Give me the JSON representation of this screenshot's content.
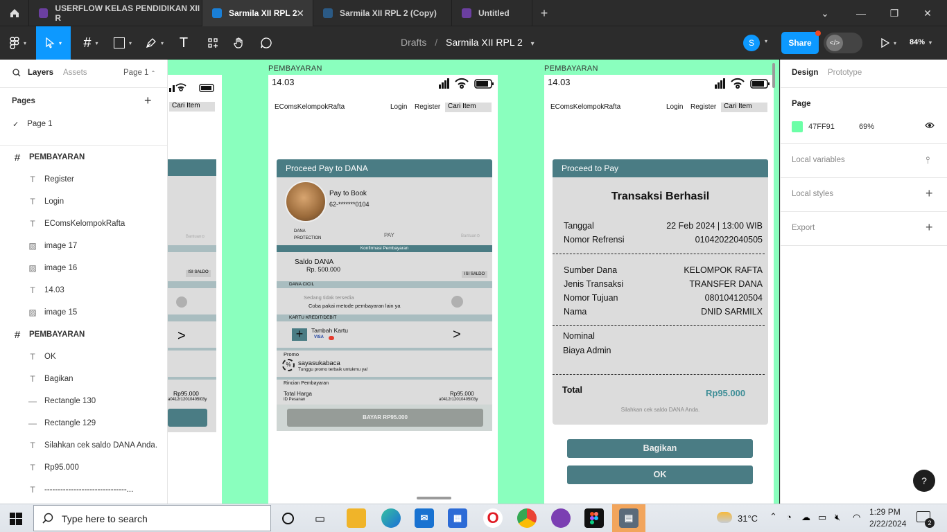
{
  "tabs": [
    {
      "label": "USERFLOW KELAS PENDIDIKAN XII R",
      "active": false
    },
    {
      "label": "Sarmila XII RPL 2",
      "active": true
    },
    {
      "label": "Sarmila XII RPL 2 (Copy)",
      "active": false
    },
    {
      "label": "Untitled",
      "active": false
    }
  ],
  "toolbar": {
    "breadcrumb_root": "Drafts",
    "breadcrumb_sep": "/",
    "file_name": "Sarmila XII RPL 2",
    "avatar_initial": "S",
    "share_label": "Share",
    "zoom": "84%"
  },
  "left_panel": {
    "tab_layers": "Layers",
    "tab_assets": "Assets",
    "page_selector": "Page 1",
    "pages_heading": "Pages",
    "current_page": "Page 1",
    "layers": [
      {
        "type": "frame",
        "name": "PEMBAYARAN"
      },
      {
        "type": "text",
        "name": "Register"
      },
      {
        "type": "text",
        "name": "Login"
      },
      {
        "type": "text",
        "name": "EComsKelompokRafta"
      },
      {
        "type": "image",
        "name": "image 17"
      },
      {
        "type": "image",
        "name": "image 16"
      },
      {
        "type": "text",
        "name": "14.03"
      },
      {
        "type": "image",
        "name": "image 15"
      },
      {
        "type": "frame",
        "name": "PEMBAYARAN"
      },
      {
        "type": "text",
        "name": "OK"
      },
      {
        "type": "text",
        "name": "Bagikan"
      },
      {
        "type": "line",
        "name": "Rectangle 130"
      },
      {
        "type": "line",
        "name": "Rectangle 129"
      },
      {
        "type": "text",
        "name": "Silahkan cek saldo DANA Anda."
      },
      {
        "type": "text",
        "name": "Rp95.000"
      },
      {
        "type": "text",
        "name": "-------------------------------..."
      }
    ]
  },
  "canvas": {
    "frame_label_1": "PEMBAYARAN",
    "frame_label_2": "PEMBAYARAN",
    "partial": {
      "cari": "Cari Item",
      "bantuan": "Bantuan",
      "isi_saldo": "ISI SALDO",
      "arrow": ">",
      "price": "Rp95.000",
      "pesanan": "a0412r12010405l03y"
    },
    "phone1": {
      "time": "14.03",
      "brand": "EComsKelompokRafta",
      "login": "Login",
      "register": "Register",
      "search": "Cari Item",
      "header": "Proceed Pay to DANA",
      "pay_to": "Pay to Book",
      "account": "62-*******0104",
      "dana_protection_1": "DANA",
      "dana_protection_2": "PROTECTION",
      "pay_label": "PAY",
      "bantuan": "Bantuan",
      "confirm": "Konfirmasi Pembayaran",
      "saldo_label": "Saldo DANA",
      "saldo_value": "Rp. 500.000",
      "isi_saldo": "ISI SALDO",
      "dana_cicil": "DANA CICIL",
      "cicil_1": "Sedang tidak tersedia",
      "cicil_2": "Coba  pakai metode pembayaran lain ya",
      "kartu": "KARTU KREDIT/DEBIT",
      "tambah_kartu": "Tambah Kartu",
      "visa": "VISA",
      "arrow": ">",
      "promo": "Promo",
      "promo_name": "sayasukabaca",
      "promo_sub": "Tunggu promo terbaik untukmu ya!",
      "rincian": "Rincian Pembayaran",
      "total_harga": "Total Harga",
      "total_value": "Rp95.000",
      "id_pesanan": "ID Pesanan",
      "id_value": "a0412r12010405l03y",
      "bayar": "BAYAR RP95.000"
    },
    "phone2": {
      "time": "14.03",
      "brand": "EComsKelompokRafta",
      "login": "Login",
      "register": "Register",
      "search": "Cari Item",
      "header": "Proceed to Pay",
      "title": "Transaksi Berhasil",
      "rows1": [
        {
          "k": "Tanggal",
          "v": "22 Feb 2024 | 13:00 WIB"
        },
        {
          "k": "Nomor Refrensi",
          "v": "01042022040505"
        }
      ],
      "rows2": [
        {
          "k": "Sumber Dana",
          "v": "KELOMPOK RAFTA"
        },
        {
          "k": "Jenis Transaksi",
          "v": "TRANSFER DANA"
        },
        {
          "k": "Nomor Tujuan",
          "v": "080104120504"
        },
        {
          "k": "Nama",
          "v": "DNID SARMILX"
        }
      ],
      "nominal": "Nominal",
      "biaya": "Biaya Admin",
      "total_label": "Total",
      "total_value": "Rp95.000",
      "note": "Silahkan cek saldo DANA Anda.",
      "bagikan": "Bagikan",
      "ok": "OK"
    }
  },
  "right_panel": {
    "tab_design": "Design",
    "tab_prototype": "Prototype",
    "page_heading": "Page",
    "page_color": "47FF91",
    "page_opacity": "69%",
    "local_variables": "Local variables",
    "local_styles": "Local styles",
    "export": "Export",
    "help": "?"
  },
  "taskbar": {
    "search_placeholder": "Type here to search",
    "weather": "31°C",
    "time": "1:29 PM",
    "date": "2/22/2024",
    "notifications": "2"
  },
  "colors": {
    "accent": "#0d99ff",
    "canvas": "#8affbe",
    "teal": "#4a7c84",
    "total_text": "#3f8e97"
  }
}
